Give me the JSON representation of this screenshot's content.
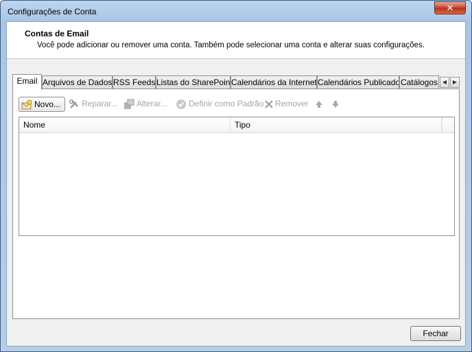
{
  "window": {
    "title": "Configurações de Conta",
    "close_label": "✕"
  },
  "header": {
    "title": "Contas de Email",
    "subtitle": "Você pode adicionar ou remover uma conta. Também pode selecionar uma conta e alterar suas configurações."
  },
  "tabs": [
    {
      "label": "Email",
      "active": true
    },
    {
      "label": "Arquivos de Dados",
      "active": false
    },
    {
      "label": "RSS Feeds",
      "active": false
    },
    {
      "label": "Listas do SharePoint",
      "active": false
    },
    {
      "label": "Calendários da Internet",
      "active": false
    },
    {
      "label": "Calendários Publicados",
      "active": false
    },
    {
      "label": "Catálogos",
      "active": false
    }
  ],
  "tab_scroll": {
    "left": "◀",
    "right": "▶"
  },
  "toolbar": {
    "new_label": "Novo...",
    "repair_label": "Reparar...",
    "change_label": "Alterar...",
    "default_label": "Definir como Padrão",
    "remove_label": "Remover",
    "up_icon": "arrow-up-icon",
    "down_icon": "arrow-down-icon"
  },
  "list": {
    "columns": [
      "Nome",
      "Tipo"
    ],
    "rows": []
  },
  "footer": {
    "close_label": "Fechar"
  },
  "colors": {
    "title_bar": "#a9c6e6",
    "close_button": "#c7452f",
    "disabled_text": "#a3a3a3"
  }
}
